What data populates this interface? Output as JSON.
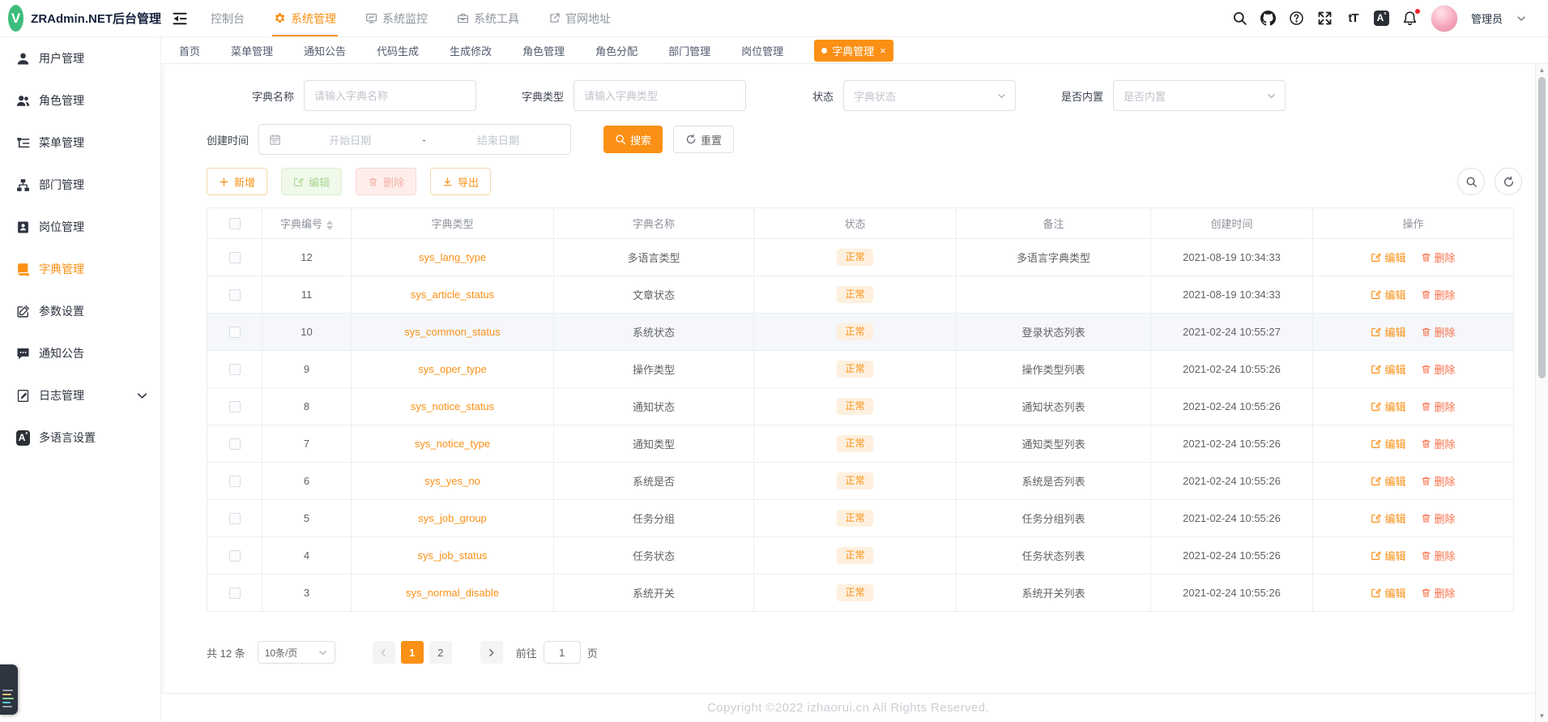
{
  "brand": {
    "logo_letter": "V",
    "title": "ZRAdmin.NET后台管理"
  },
  "header": {
    "nav": [
      {
        "label": "控制台",
        "icon": "",
        "active": false
      },
      {
        "label": "系统管理",
        "icon": "gear-icon",
        "active": true
      },
      {
        "label": "系统监控",
        "icon": "monitor-icon",
        "active": false
      },
      {
        "label": "系统工具",
        "icon": "toolbox-icon",
        "active": false
      },
      {
        "label": "官网地址",
        "icon": "external-link-icon",
        "active": false
      }
    ],
    "action_icons": [
      "search-icon",
      "github-icon",
      "help-icon",
      "fullscreen-icon",
      "font-size-icon",
      "translate-icon",
      "bell-icon"
    ],
    "user_name": "管理员"
  },
  "tabs": {
    "close_glyph": "×",
    "items": [
      {
        "label": "首页",
        "active": false
      },
      {
        "label": "菜单管理",
        "active": false
      },
      {
        "label": "通知公告",
        "active": false
      },
      {
        "label": "代码生成",
        "active": false
      },
      {
        "label": "生成修改",
        "active": false
      },
      {
        "label": "角色管理",
        "active": false
      },
      {
        "label": "角色分配",
        "active": false
      },
      {
        "label": "部门管理",
        "active": false
      },
      {
        "label": "岗位管理",
        "active": false
      },
      {
        "label": "字典管理",
        "active": true
      }
    ]
  },
  "sidebar": {
    "items": [
      {
        "label": "用户管理",
        "icon": "user-icon",
        "active": false
      },
      {
        "label": "角色管理",
        "icon": "roles-icon",
        "active": false
      },
      {
        "label": "菜单管理",
        "icon": "menu-tree-icon",
        "active": false
      },
      {
        "label": "部门管理",
        "icon": "org-icon",
        "active": false
      },
      {
        "label": "岗位管理",
        "icon": "badge-icon",
        "active": false
      },
      {
        "label": "字典管理",
        "icon": "dict-icon",
        "active": true
      },
      {
        "label": "参数设置",
        "icon": "settings-edit-icon",
        "active": false
      },
      {
        "label": "通知公告",
        "icon": "notice-icon",
        "active": false
      },
      {
        "label": "日志管理",
        "icon": "log-icon",
        "active": false,
        "expandable": true
      },
      {
        "label": "多语言设置",
        "icon": "language-icon",
        "active": false
      }
    ]
  },
  "filters": {
    "dict_name": {
      "label": "字典名称",
      "placeholder": "请输入字典名称"
    },
    "dict_type": {
      "label": "字典类型",
      "placeholder": "请输入字典类型"
    },
    "status": {
      "label": "状态",
      "placeholder": "字典状态"
    },
    "builtin": {
      "label": "是否内置",
      "placeholder": "是否内置"
    },
    "created": {
      "label": "创建时间",
      "start_placeholder": "开始日期",
      "separator": "-",
      "end_placeholder": "结束日期"
    },
    "search_label": "搜索",
    "reset_label": "重置"
  },
  "toolbar": {
    "add": "新增",
    "edit": "编辑",
    "delete": "删除",
    "export": "导出"
  },
  "table": {
    "columns": [
      "字典编号",
      "字典类型",
      "字典名称",
      "状态",
      "备注",
      "创建时间",
      "操作"
    ],
    "edit_label": "编辑",
    "delete_label": "删除",
    "rows": [
      {
        "id": "12",
        "type": "sys_lang_type",
        "name": "多语言类型",
        "status": "正常",
        "remark": "多语言字典类型",
        "created": "2021-08-19 10:34:33",
        "hover": false
      },
      {
        "id": "11",
        "type": "sys_article_status",
        "name": "文章状态",
        "status": "正常",
        "remark": "",
        "created": "2021-08-19 10:34:33",
        "hover": false
      },
      {
        "id": "10",
        "type": "sys_common_status",
        "name": "系统状态",
        "status": "正常",
        "remark": "登录状态列表",
        "created": "2021-02-24 10:55:27",
        "hover": true
      },
      {
        "id": "9",
        "type": "sys_oper_type",
        "name": "操作类型",
        "status": "正常",
        "remark": "操作类型列表",
        "created": "2021-02-24 10:55:26",
        "hover": false
      },
      {
        "id": "8",
        "type": "sys_notice_status",
        "name": "通知状态",
        "status": "正常",
        "remark": "通知状态列表",
        "created": "2021-02-24 10:55:26",
        "hover": false
      },
      {
        "id": "7",
        "type": "sys_notice_type",
        "name": "通知类型",
        "status": "正常",
        "remark": "通知类型列表",
        "created": "2021-02-24 10:55:26",
        "hover": false
      },
      {
        "id": "6",
        "type": "sys_yes_no",
        "name": "系统是否",
        "status": "正常",
        "remark": "系统是否列表",
        "created": "2021-02-24 10:55:26",
        "hover": false
      },
      {
        "id": "5",
        "type": "sys_job_group",
        "name": "任务分组",
        "status": "正常",
        "remark": "任务分组列表",
        "created": "2021-02-24 10:55:26",
        "hover": false
      },
      {
        "id": "4",
        "type": "sys_job_status",
        "name": "任务状态",
        "status": "正常",
        "remark": "任务状态列表",
        "created": "2021-02-24 10:55:26",
        "hover": false
      },
      {
        "id": "3",
        "type": "sys_normal_disable",
        "name": "系统开关",
        "status": "正常",
        "remark": "系统开关列表",
        "created": "2021-02-24 10:55:26",
        "hover": false
      }
    ]
  },
  "pagination": {
    "total": "共 12 条",
    "page_size": "10条/页",
    "pages": [
      "1",
      "2"
    ],
    "active_page": "1",
    "goto_label": "前往",
    "goto_value": "1",
    "unit_label": "页"
  },
  "footer": {
    "copyright": "Copyright ©2022 izhaorui.cn All Rights Reserved."
  },
  "colors": {
    "accent": "#fa9015",
    "accent_light_bg": "#fdf0de",
    "delete_link": "#f9704a",
    "logo_green": "#3dbd7d",
    "notification_dot": "#f5222d"
  }
}
